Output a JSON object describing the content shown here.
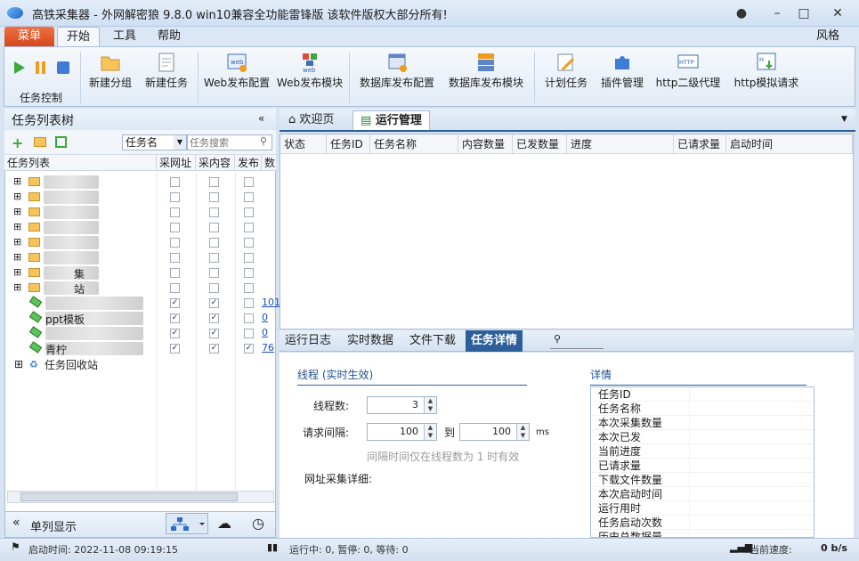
{
  "window": {
    "title": "高铁采集器 - 外网解密狼 9.8.0 win10兼容全功能雷锋版 该软件版权大部分所有!"
  },
  "ribbon_tabs": {
    "menu": "菜单",
    "start": "开始",
    "tools": "工具",
    "help": "帮助",
    "style": "风格"
  },
  "ribbon": {
    "task_control": "任务控制",
    "new_group": "新建分组",
    "new_task": "新建任务",
    "web_publish_config": "Web发布配置",
    "web_publish_module": "Web发布模块",
    "db_publish_config": "数据库发布配置",
    "db_publish_module": "数据库发布模块",
    "scheduled_task": "计划任务",
    "plugin_manager": "插件管理",
    "http_proxy": "http二级代理",
    "http_simulate": "http模拟请求"
  },
  "left_panel": {
    "title": "任务列表树",
    "filter_select": "任务名",
    "search_placeholder": "任务搜索",
    "columns": [
      "任务列表",
      "采网址",
      "采内容",
      "发布",
      "数"
    ],
    "rows": [
      {
        "label": "",
        "c1": false,
        "c2": false,
        "c3": false,
        "num": ""
      },
      {
        "label": "",
        "c1": false,
        "c2": false,
        "c3": false,
        "num": ""
      },
      {
        "label": "",
        "c1": false,
        "c2": false,
        "c3": false,
        "num": ""
      },
      {
        "label": "",
        "c1": false,
        "c2": false,
        "c3": false,
        "num": ""
      },
      {
        "label": "",
        "c1": false,
        "c2": false,
        "c3": false,
        "num": ""
      },
      {
        "label": "",
        "c1": false,
        "c2": false,
        "c3": false,
        "num": ""
      },
      {
        "label": "集",
        "c1": false,
        "c2": false,
        "c3": false,
        "num": ""
      },
      {
        "label": "站",
        "c1": false,
        "c2": false,
        "c3": false,
        "num": ""
      },
      {
        "label": "",
        "c1": true,
        "c2": true,
        "c3": false,
        "num": "101"
      },
      {
        "label": "ppt模板",
        "c1": true,
        "c2": true,
        "c3": false,
        "num": "0"
      },
      {
        "label": "",
        "c1": true,
        "c2": true,
        "c3": false,
        "num": "0"
      },
      {
        "label": "青柠",
        "c1": true,
        "c2": true,
        "c3": true,
        "num": "76"
      }
    ],
    "recycle": "任务回收站",
    "single_column": "单列显示"
  },
  "right_tabs": {
    "welcome": "欢迎页",
    "run_manage": "运行管理"
  },
  "task_columns": [
    "状态",
    "任务ID",
    "任务名称",
    "内容数量",
    "已发数量",
    "进度",
    "已请求量",
    "启动时间"
  ],
  "bottom_tabs": {
    "log": "运行日志",
    "realtime": "实时数据",
    "download": "文件下载",
    "detail": "任务详情"
  },
  "thread": {
    "section": "线程 (实时生效)",
    "count_label": "线程数:",
    "count_value": "3",
    "interval_label": "请求间隔:",
    "interval_from": "100",
    "to_label": "到",
    "interval_to": "100",
    "unit": "ms",
    "hint": "间隔时间仅在线程数为 1 时有效",
    "url_detail": "网址采集详细:"
  },
  "details": {
    "title": "详情",
    "items": [
      "任务ID",
      "任务名称",
      "本次采集数量",
      "本次已发",
      "当前进度",
      "已请求量",
      "下载文件数量",
      "本次启动时间",
      "运行用时",
      "任务启动次数",
      "历史总数据量"
    ]
  },
  "status": {
    "start_time": "启动时间: 2022-11-08 09:19:15",
    "running": "运行中: 0, 暂停: 0, 等待: 0",
    "speed_label": "当前速度:",
    "speed_value": "0 b/s"
  }
}
